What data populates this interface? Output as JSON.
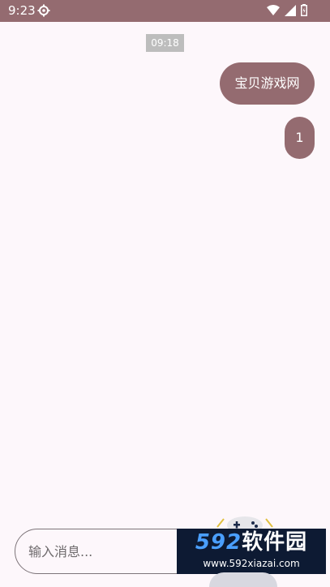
{
  "status_bar": {
    "time": "9:23",
    "icons": [
      "gear-icon",
      "wifi-icon",
      "signal-icon",
      "battery-icon"
    ]
  },
  "chat": {
    "timestamp": "09:18",
    "messages": [
      {
        "text": "宝贝游戏网",
        "sender": "me"
      },
      {
        "text": "1",
        "sender": "me"
      }
    ]
  },
  "input": {
    "placeholder": "输入消息..."
  },
  "watermark": {
    "digits": "592",
    "name": "软件园",
    "url": "www.592xiazai.com"
  },
  "colors": {
    "accent": "#946b70",
    "background": "#fdf7fb",
    "timestamp_bg": "#bdbdbd"
  }
}
